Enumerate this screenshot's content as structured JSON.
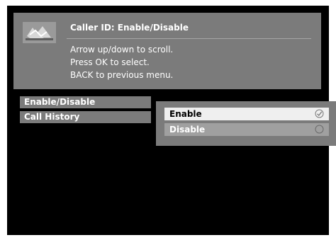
{
  "header": {
    "title": "Caller ID: Enable/Disable",
    "icon": "caller-id-icon",
    "help_lines": [
      "Arrow up/down to scroll.",
      "Press OK to select.",
      "BACK to previous menu."
    ]
  },
  "menu": {
    "items": [
      {
        "label": "Enable/Disable"
      },
      {
        "label": "Call History"
      }
    ]
  },
  "options": {
    "items": [
      {
        "label": "Enable",
        "selected": true,
        "icon": "checkmark-circle-icon"
      },
      {
        "label": "Disable",
        "selected": false,
        "icon": "empty-circle-icon"
      }
    ]
  },
  "colors": {
    "screen_bg": "#000000",
    "panel_bg": "#7b7b7b",
    "selected_bg": "#efefef",
    "unselected_bg": "#a0a0a0",
    "text": "#ffffff"
  }
}
